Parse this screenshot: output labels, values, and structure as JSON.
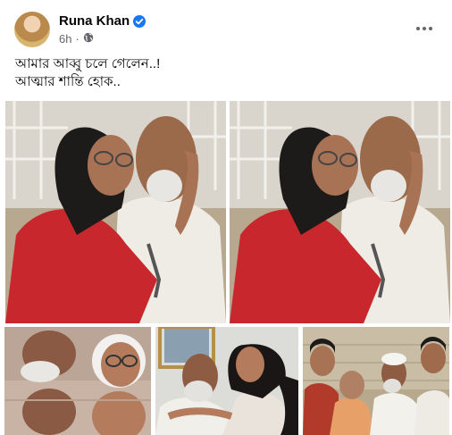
{
  "post": {
    "author": "Runa Khan",
    "time": "6h",
    "privacy_icon": "globe-icon",
    "lines": [
      "আমার আব্বু চলে গেলেন..!",
      "আত্মার শান্তি হোক.."
    ]
  },
  "photos": [
    {
      "name": "photo-1"
    },
    {
      "name": "photo-2"
    },
    {
      "name": "photo-3"
    },
    {
      "name": "photo-4"
    },
    {
      "name": "photo-5"
    }
  ],
  "colors": {
    "verified_badge": "#1877f2",
    "secondary_text": "#65676b",
    "primary_text": "#050505"
  }
}
